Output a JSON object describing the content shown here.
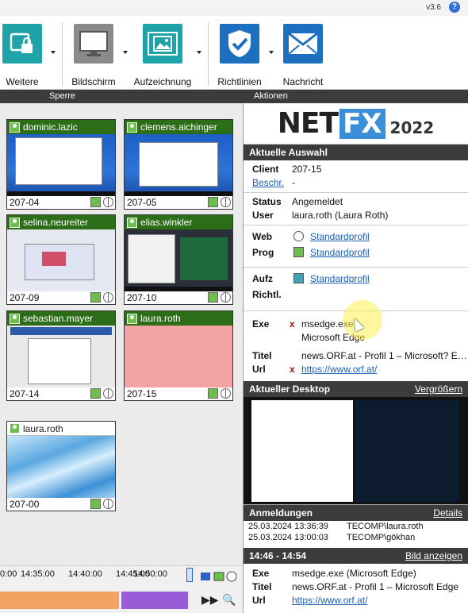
{
  "app": {
    "version": "v3.6"
  },
  "ribbon": {
    "buttons": [
      {
        "label": "Weitere",
        "icon": "lock-screen-icon"
      },
      {
        "label": "Bildschirm",
        "icon": "monitor-icon"
      },
      {
        "label": "Aufzeichnung",
        "icon": "recording-icon"
      },
      {
        "label": "Richtlinien",
        "icon": "shield-check-icon"
      },
      {
        "label": "Nachricht",
        "icon": "envelope-icon"
      }
    ],
    "groups": {
      "left": "Sperre",
      "right": "Aktionen"
    }
  },
  "tiles": [
    {
      "user": "dominic.lazic",
      "client": "207-04"
    },
    {
      "user": "clemens.aichinger",
      "client": "207-05"
    },
    {
      "user": "selina.neureiter",
      "client": "207-09"
    },
    {
      "user": "elias.winkler",
      "client": "207-10"
    },
    {
      "user": "sebastian.mayer",
      "client": "207-14"
    },
    {
      "user": "laura.roth",
      "client": "207-15"
    },
    {
      "user": "laura.roth",
      "client": "207-00"
    }
  ],
  "timeline": {
    "ticks": [
      "0:00",
      "14:35:00",
      "14:40:00",
      "14:45:00",
      "14:50:00"
    ]
  },
  "logo": {
    "net": "NET",
    "fx": "FX",
    "year": "2022"
  },
  "selection": {
    "header": "Aktuelle Auswahl",
    "client_label": "Client",
    "client_value": "207-15",
    "beschr_label": "Beschr.",
    "beschr_value": "-",
    "status_label": "Status",
    "status_value": "Angemeldet",
    "user_label": "User",
    "user_value": "laura.roth (Laura Roth)",
    "web_label": "Web",
    "web_value": "Standardprofil",
    "prog_label": "Prog",
    "prog_value": "Standardprofil",
    "aufz_label": "Aufz",
    "aufz_value": "Standardprofil",
    "richtl_label": "Richtl.",
    "exe_label": "Exe",
    "exe_value": "msedge.exe",
    "exe_sub": "Microsoft Edge",
    "titel_label": "Titel",
    "titel_value": "news.ORF.at - Profil 1 – Microsoft? Ed...",
    "url_label": "Url",
    "url_value": "https://www.orf.at/"
  },
  "desktop": {
    "header": "Aktueller Desktop",
    "link": "Vergrößern"
  },
  "logins": {
    "header": "Anmeldungen",
    "link": "Details",
    "rows": [
      {
        "date": "25.03.2024 13:36:39",
        "user": "TECOMP\\laura.roth"
      },
      {
        "date": "25.03.2024 13:00:03",
        "user": "TECOMP\\gökhan"
      }
    ]
  },
  "timeslot": {
    "header": "14:46 - 14:54",
    "link": "Bild anzeigen",
    "exe_label": "Exe",
    "exe_value": "msedge.exe (Microsoft Edge)",
    "titel_label": "Titel",
    "titel_value": "news.ORF.at - Profil 1 – Microsoft Edge",
    "url_label": "Url",
    "url_value": "https://www.orf.at/"
  }
}
